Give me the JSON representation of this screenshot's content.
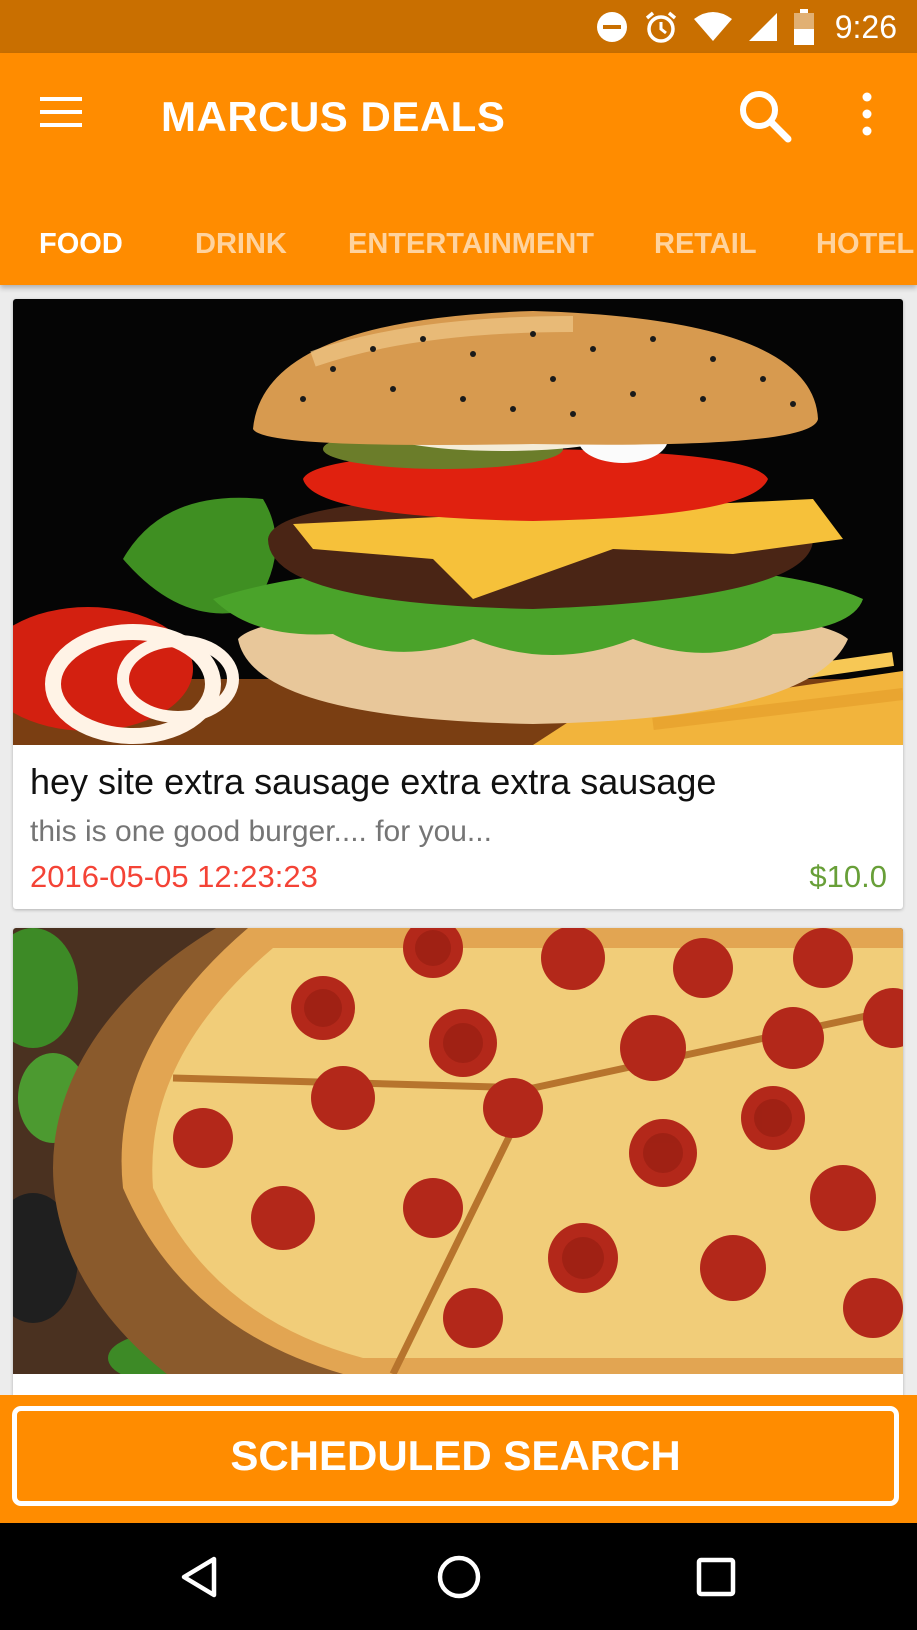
{
  "status_bar": {
    "time": "9:26",
    "icons": [
      "do-not-disturb-icon",
      "alarm-icon",
      "wifi-icon",
      "signal-icon",
      "battery-icon"
    ]
  },
  "app_bar": {
    "title": "MARCUS DEALS",
    "icons": [
      "menu-icon",
      "search-icon",
      "more-vert-icon"
    ]
  },
  "tabs": [
    {
      "label": "FOOD",
      "active": true
    },
    {
      "label": "DRINK",
      "active": false
    },
    {
      "label": "ENTERTAINMENT",
      "active": false
    },
    {
      "label": "RETAIL",
      "active": false
    },
    {
      "label": "HOTEL",
      "active": false
    }
  ],
  "deals": [
    {
      "image": "burger-photo",
      "title": "hey site extra sausage extra extra sausage",
      "description": "this is one good burger.... for you...",
      "date": "2016-05-05 12:23:23",
      "price": "$10.0"
    },
    {
      "image": "pepperoni-pizza-photo"
    }
  ],
  "bottom_button": {
    "label": "SCHEDULED SEARCH"
  },
  "nav_bar": {
    "icons": [
      "back-icon",
      "home-icon",
      "recents-icon"
    ]
  },
  "colors": {
    "status_bar": "#c96f00",
    "primary": "#ff8c00",
    "date_text": "#f44336",
    "price_text": "#689f38"
  }
}
